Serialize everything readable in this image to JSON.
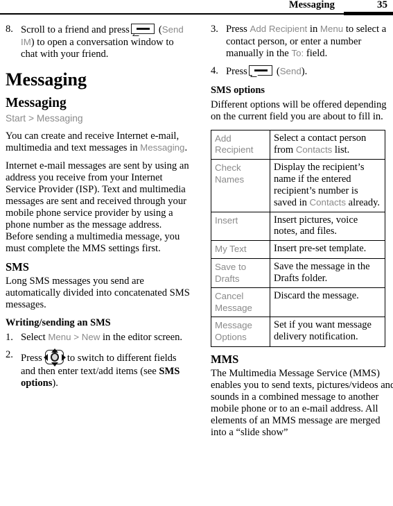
{
  "header": {
    "title": "Messaging",
    "page_number": "35"
  },
  "left_column": {
    "step8": {
      "num": "8.",
      "text_before_icon": "Scroll to a friend and press",
      "icon": "softkey-icon",
      "ui_term": "Send IM",
      "text_after": ") to open a conversation window to chat with your friend.",
      "paren_open": "("
    },
    "chapter_title": "Messaging",
    "section_title": "Messaging",
    "path": "Start > Messaging",
    "intro_p1_a": "You can create and receive Internet e-mail, multimedia and text messages in ",
    "intro_p1_ui": "Messaging",
    "intro_p1_b": ".",
    "intro_p2": "Internet e-mail messages are sent by using an address you receive from your Internet Service Provider (ISP). Text and multimedia messages are sent and received through your mobile phone service provider by using a phone number as the message address. Before sending a multimedia message, you must complete the MMS settings first.",
    "sms_heading": "SMS",
    "sms_body": "Long SMS messages you send are automatically divided into concatenated SMS messages.",
    "writing_heading": "Writing/sending an SMS",
    "step1": {
      "num": "1.",
      "a": "Select ",
      "ui_menu": "Menu",
      "gt": " > ",
      "ui_new": "New",
      "b": " in the editor screen."
    },
    "step2": {
      "num": "2.",
      "a": "Press",
      "icon": "navigation-key-icon",
      "b": "to switch to different fields and then enter text/add items (see ",
      "bold_term": "SMS options",
      "c": ")."
    }
  },
  "right_column": {
    "step3": {
      "num": "3.",
      "a": "Press ",
      "ui_add_recipient": "Add Recipient",
      "b": " in ",
      "ui_menu": "Menu",
      "c": " to select a contact person, or enter a number manually in the ",
      "ui_to": "To:",
      "d": " field."
    },
    "step4": {
      "num": "4.",
      "a": "Press",
      "icon": "softkey-icon",
      "paren_open": "(",
      "ui_send": "Send",
      "paren_close": ")."
    },
    "sms_options_heading": "SMS options",
    "sms_options_body": "Different options will be offered depending on the current field you are about to fill in.",
    "table": {
      "rows": [
        {
          "key": "Add Recipient",
          "value_a": "Select a contact person from ",
          "value_ui": "Contacts",
          "value_b": " list."
        },
        {
          "key": "Check Names",
          "value_a": "Display the recipient’s name if the entered recipient’s number is saved in ",
          "value_ui": "Contacts",
          "value_b": " already."
        },
        {
          "key": "Insert",
          "value_a": "Insert pictures, voice notes, and files.",
          "value_ui": "",
          "value_b": ""
        },
        {
          "key": "My Text",
          "value_a": "Insert pre-set template.",
          "value_ui": "",
          "value_b": ""
        },
        {
          "key": "Save to Drafts",
          "value_a": "Save the message in the Drafts folder.",
          "value_ui": "",
          "value_b": ""
        },
        {
          "key": "Cancel Message",
          "value_a": "Discard the message.",
          "value_ui": "",
          "value_b": ""
        },
        {
          "key": "Message Options",
          "value_a": "Set if you want message delivery notification.",
          "value_ui": "",
          "value_b": ""
        }
      ]
    },
    "mms_heading": "MMS",
    "mms_body": "The Multimedia Message Service (MMS) enables you to send texts, pictures/videos and sounds in a combined message to another mobile phone or to an e-mail address. All elements of an MMS message are merged into a “slide show”"
  },
  "colors": {
    "ui_term_gray": "#8a8a8a",
    "text_black": "#000000",
    "page_background": "#ffffff"
  }
}
